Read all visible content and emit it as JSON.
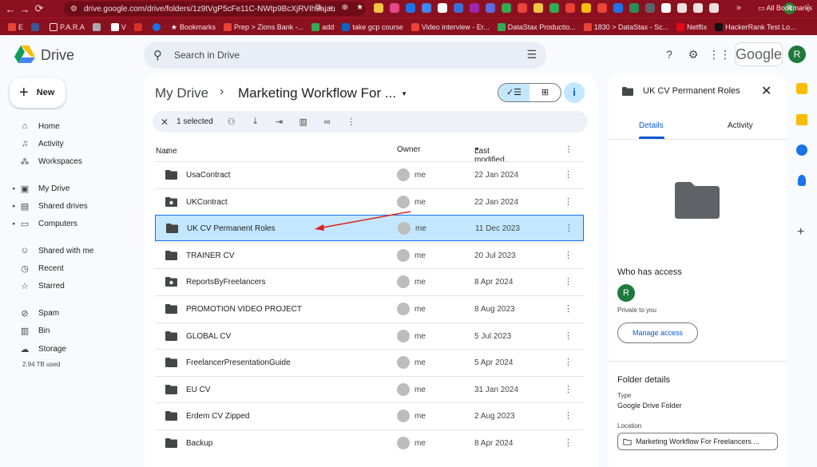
{
  "browser": {
    "url": "drive.google.com/drive/folders/1z9tVgP5cFe11C-NWtp9BcXjRVIh3ajau",
    "bookmarks": [
      "E",
      "P.A.R.A",
      "V",
      "Bookmarks",
      "Prep > Zions Bank -...",
      "add",
      "take gcp course",
      "Video interview - Er...",
      "DataStax Productio...",
      "1830 > DataStax - Sc...",
      "Netflix",
      "HackerRank Test Lo..."
    ],
    "all_bookmarks": "All Bookmarks",
    "profile_initial": "R"
  },
  "header": {
    "product": "Drive",
    "search_placeholder": "Search in Drive",
    "google_label": "Google",
    "avatar_initial": "R"
  },
  "sidebar": {
    "new_label": "New",
    "items": [
      {
        "label": "Home",
        "icon": "home-icon"
      },
      {
        "label": "Activity",
        "icon": "bell-icon"
      },
      {
        "label": "Workspaces",
        "icon": "workspaces-icon"
      },
      {
        "label": "My Drive",
        "icon": "my-drive-icon"
      },
      {
        "label": "Shared drives",
        "icon": "shared-drives-icon"
      },
      {
        "label": "Computers",
        "icon": "computer-icon"
      },
      {
        "label": "Shared with me",
        "icon": "people-icon"
      },
      {
        "label": "Recent",
        "icon": "clock-icon"
      },
      {
        "label": "Starred",
        "icon": "star-icon"
      },
      {
        "label": "Spam",
        "icon": "spam-icon"
      },
      {
        "label": "Bin",
        "icon": "trash-icon"
      },
      {
        "label": "Storage",
        "icon": "cloud-icon"
      }
    ],
    "storage_used": "2.94 TB used"
  },
  "main": {
    "breadcrumb_root": "My Drive",
    "breadcrumb_sep": "›",
    "breadcrumb_current": "Marketing Workflow For ...",
    "selection": {
      "count_label": "1 selected"
    },
    "columns": {
      "name": "Name",
      "owner": "Owner",
      "modified": "Last modified"
    },
    "rows": [
      {
        "name": "UsaContract",
        "owner": "me",
        "modified": "22 Jan 2024",
        "shared": false
      },
      {
        "name": "UKContract",
        "owner": "me",
        "modified": "22 Jan 2024",
        "shared": true
      },
      {
        "name": "UK CV Permanent Roles",
        "owner": "me",
        "modified": "11 Dec 2023",
        "shared": false
      },
      {
        "name": "TRAINER CV",
        "owner": "me",
        "modified": "20 Jul 2023",
        "shared": false
      },
      {
        "name": "ReportsByFreelancers",
        "owner": "me",
        "modified": "8 Apr 2024",
        "shared": true
      },
      {
        "name": "PROMOTION VIDEO PROJECT",
        "owner": "me",
        "modified": "8 Aug 2023",
        "shared": false
      },
      {
        "name": "GLOBAL CV",
        "owner": "me",
        "modified": "5 Jul 2023",
        "shared": false
      },
      {
        "name": "FreelancerPresentationGuide",
        "owner": "me",
        "modified": "5 Apr 2024",
        "shared": false
      },
      {
        "name": "EU CV",
        "owner": "me",
        "modified": "31 Jan 2024",
        "shared": false
      },
      {
        "name": "Erdem CV Zipped",
        "owner": "me",
        "modified": "2 Aug 2023",
        "shared": false
      },
      {
        "name": "Backup",
        "owner": "me",
        "modified": "8 Apr 2024",
        "shared": false
      }
    ]
  },
  "details": {
    "title": "UK CV Permanent Roles",
    "tabs": [
      "Details",
      "Activity"
    ],
    "who_has_access": "Who has access",
    "access_avatar": "R",
    "private_label": "Private to you",
    "manage_access": "Manage access",
    "folder_details": "Folder details",
    "type_label": "Type",
    "type_value": "Google Drive Folder",
    "location_label": "Location",
    "location_value": "Marketing Workflow For Freelancers ..."
  },
  "colors": {
    "chrome": "#8b1020",
    "selected_row": "#c2e7ff",
    "accent": "#0b57d0",
    "annotation_arrow": "#e0201c"
  }
}
